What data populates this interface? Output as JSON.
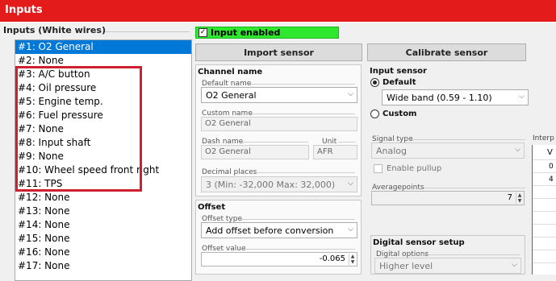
{
  "window": {
    "title": "Inputs"
  },
  "inputs": {
    "group_label": "Inputs (White wires)",
    "items": [
      "#1: O2 General",
      "#2: None",
      "#3: A/C button",
      "#4: Oil pressure",
      "#5: Engine temp.",
      "#6: Fuel pressure",
      "#7: None",
      "#8: Input shaft",
      "#9: None",
      "#10: Wheel speed front right",
      "#11: TPS",
      "#12: None",
      "#13: None",
      "#14: None",
      "#15: None",
      "#16: None",
      "#17: None"
    ],
    "selected_index": 0
  },
  "toolbar": {
    "input_enabled_label": "Input enabled",
    "import_label": "Import sensor",
    "calibrate_label": "Calibrate sensor"
  },
  "channel": {
    "title": "Channel name",
    "default_name_label": "Default name",
    "default_name_value": "O2 General",
    "custom_name_label": "Custom name",
    "custom_name_value": "O2 General",
    "dash_name_label": "Dash name",
    "dash_name_value": "O2 General",
    "unit_label": "Unit",
    "unit_value": "AFR",
    "decimal_label": "Decimal places",
    "decimal_value": "3 (Min: -32,000 Max: 32,000)"
  },
  "offset": {
    "title": "Offset",
    "type_label": "Offset type",
    "type_value": "Add offset before conversion",
    "value_label": "Offset value",
    "value": "-0.065"
  },
  "input_sensor": {
    "title": "Input sensor",
    "default_label": "Default",
    "sensor_value": "Wide band (0.59 - 1.10)",
    "custom_label": "Custom",
    "signal_type_label": "Signal type",
    "signal_type_value": "Analog",
    "pullup_label": "Enable pullup",
    "averagepoints_label": "Averagepoints",
    "averagepoints_value": "7",
    "interp_label": "Interp",
    "grid_cells": [
      "V",
      "0",
      "4"
    ]
  },
  "digital": {
    "title": "Digital sensor setup",
    "options_label": "Digital options",
    "options_value": "Higher level"
  }
}
